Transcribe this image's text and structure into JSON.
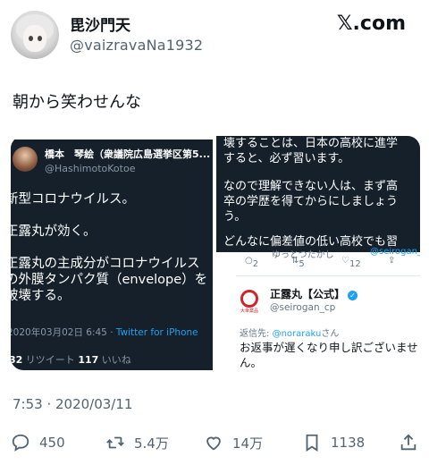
{
  "author": {
    "name": "毘沙門天",
    "handle": "@vaizravaNa1932"
  },
  "brand": "𝕏.com",
  "tweet": {
    "text": "朝から笑わせんな",
    "timestamp": "7:53 · 2020/03/11"
  },
  "quoted_left": {
    "name": "橋本　琴絵（衆議院広島選挙区第5...",
    "handle": "@HashimotoKotoe",
    "lines": [
      "新型コロナウイルス。",
      "正露丸が効く。",
      "正露丸の主成分がコロナウイルス",
      "の外膜タンパク質（envelope）を",
      "破壊する。"
    ],
    "meta_time": "2020年03月02日 6:45 · ",
    "meta_via": "Twitter for iPhone",
    "stats_retweets": "32",
    "stats_retweets_label": " リツイート  ",
    "stats_likes": "117",
    "stats_likes_label": " いいね"
  },
  "quoted_right_top": {
    "line1": "壊することは、日本の高校に進学\nすると、必ず習います。",
    "line2": "なので理解できない人は、まず高\n卒の学歴を得てからにしましょう\nう。",
    "line3": "どんなに偏差値の低い高校でも習"
  },
  "quoted_right_bottom": {
    "counts": [
      "2",
      "5",
      "12"
    ],
    "cut_top": "ゆっとつたかし",
    "cut_top2": "@seirogan_cp",
    "logo_label": "大幸薬品",
    "name": "正露丸【公式】",
    "handle": "@seirogan_cp",
    "reply_prefix": "返信先: ",
    "reply_to": "@noraraku",
    "reply_suffix": "さん",
    "text": "お返事が遅くなり申し訳ございませ\nん。"
  },
  "actions": {
    "replies": "450",
    "retweets": "5.4万",
    "likes": "14万",
    "bookmarks": "1138"
  },
  "icons": [
    "reply-icon",
    "retweet-icon",
    "like-icon",
    "bookmark-icon",
    "share-icon",
    "verified-icon"
  ],
  "colors": {
    "text_primary": "#0f1419",
    "text_secondary": "#536471",
    "dark_bg": "#15202b",
    "link_blue": "#1da1f2",
    "seirogan_red": "#d0242a"
  }
}
